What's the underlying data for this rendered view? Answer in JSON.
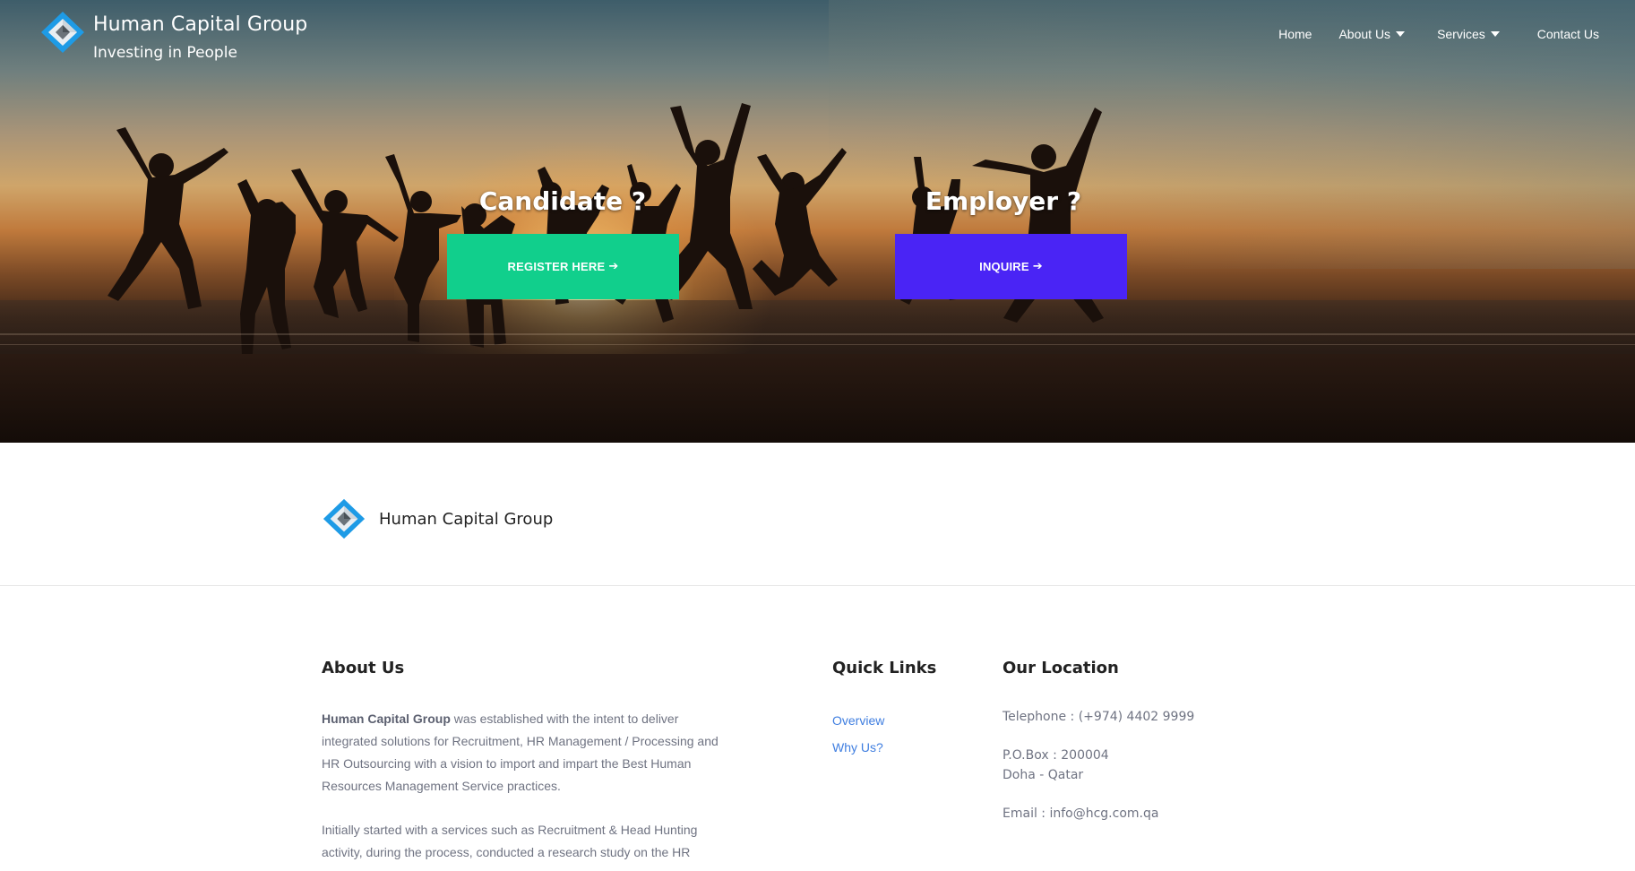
{
  "brand": {
    "title": "Human Capital Group",
    "tagline": "Investing in People"
  },
  "nav": {
    "items": [
      {
        "label": "Home",
        "dropdown": false
      },
      {
        "label": "About Us",
        "dropdown": true
      },
      {
        "label": "Services",
        "dropdown": true
      },
      {
        "label": "Contact Us",
        "dropdown": false
      }
    ]
  },
  "hero": {
    "candidate": {
      "heading": "Candidate ?",
      "button_label": "REGISTER HERE",
      "button_color": "#11cf8c"
    },
    "employer": {
      "heading": "Employer ?",
      "button_label": "INQUIRE",
      "button_color": "#4a24f5"
    },
    "arrow_icon": "arrow-right-icon"
  },
  "logo_band": {
    "name": "Human Capital Group"
  },
  "footer": {
    "about": {
      "heading": "About Us",
      "lead_bold": "Human Capital Group",
      "lead_rest": " was established with the intent to deliver integrated solutions for Recruitment, HR Management / Processing and HR Outsourcing with a vision to import and impart the Best Human Resources Management Service practices.",
      "p2": "Initially started with a services such as Recruitment & Head Hunting activity, during the process, conducted a research study on the HR"
    },
    "quick_links": {
      "heading": "Quick Links",
      "items": [
        "Overview",
        "Why Us?"
      ]
    },
    "location": {
      "heading": "Our Location",
      "telephone": "Telephone : (+974) 4402 9999",
      "po_box": "P.O.Box : 200004",
      "city": "Doha - Qatar",
      "email": "Email : info@hcg.com.qa"
    }
  },
  "colors": {
    "logo_blue": "#1e9be6",
    "link_blue": "#3f7ee0",
    "body_text": "#6f7382"
  }
}
